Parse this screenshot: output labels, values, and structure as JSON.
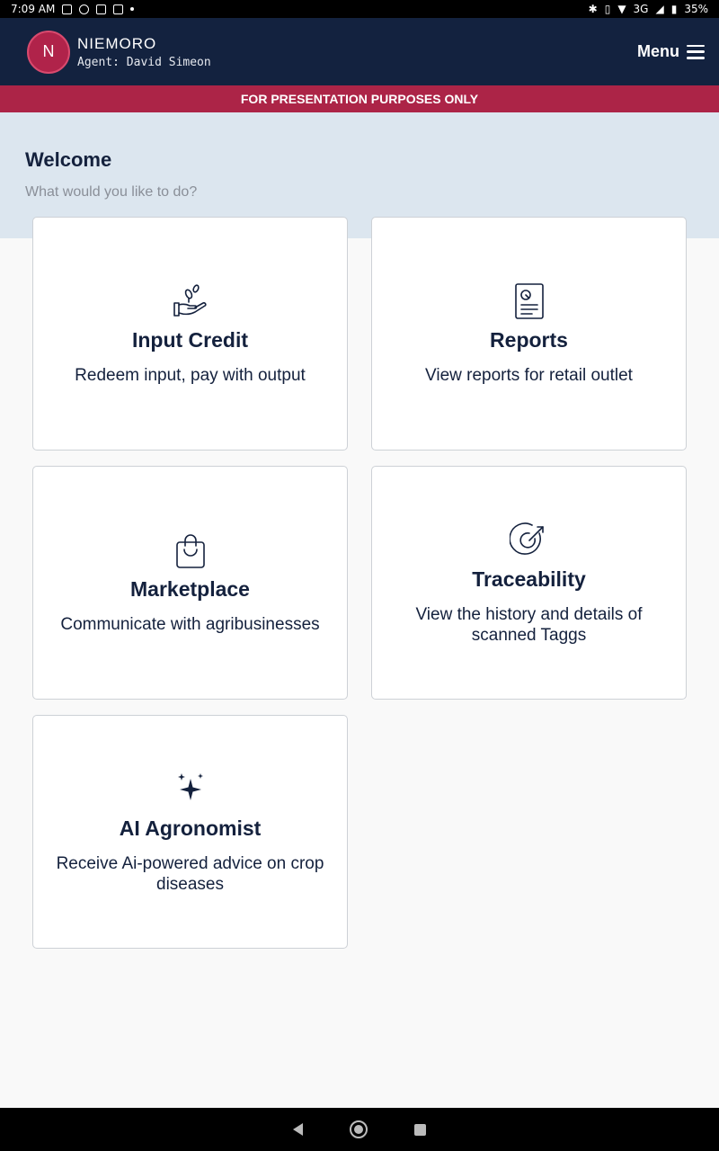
{
  "status_bar": {
    "time": "7:09 AM",
    "network": "3G",
    "battery": "35%"
  },
  "header": {
    "avatar_initial": "N",
    "app_name": "NIEMORO",
    "agent_label": "Agent: David Simeon",
    "menu_label": "Menu"
  },
  "banner": {
    "text": "FOR PRESENTATION PURPOSES ONLY",
    "color": "#ac2447"
  },
  "welcome": {
    "title": "Welcome",
    "subtitle": "What would you like to do?"
  },
  "cards": [
    {
      "icon": "seedling-hand-icon",
      "title": "Input Credit",
      "description": "Redeem input, pay with output"
    },
    {
      "icon": "report-document-icon",
      "title": "Reports",
      "description": "View reports for retail outlet"
    },
    {
      "icon": "shopping-bag-icon",
      "title": "Marketplace",
      "description": "Communicate with agribusinesses"
    },
    {
      "icon": "target-arrow-icon",
      "title": "Traceability",
      "description": "View the history and details of scanned Taggs"
    },
    {
      "icon": "sparkles-icon",
      "title": "AI Agronomist",
      "description": "Receive Ai-powered advice on crop diseases"
    }
  ],
  "colors": {
    "header_bg": "#13223f",
    "accent": "#b0234a",
    "welcome_bg": "#dce6ef"
  }
}
